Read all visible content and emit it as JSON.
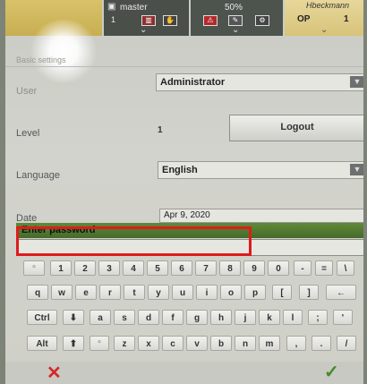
{
  "header": {
    "user_name": "master",
    "user_sub": "1",
    "zoom_percent": "50%",
    "op_label": "OP",
    "op_value": "1",
    "brand": "Hbeckmann"
  },
  "breadcrumb": "Basic settings",
  "form": {
    "user_label": "User",
    "user_value": "Administrator",
    "level_label": "Level",
    "level_value": "1",
    "logout_label": "Logout",
    "language_label": "Language",
    "language_value": "English",
    "date_label": "Date",
    "date_value": "Apr 9, 2020"
  },
  "password": {
    "prompt": "Enter password",
    "value": ""
  },
  "keyboard": {
    "row1": [
      "°",
      "1",
      "2",
      "3",
      "4",
      "5",
      "6",
      "7",
      "8",
      "9",
      "0",
      "-",
      "=",
      "\\"
    ],
    "row2": [
      "q",
      "w",
      "e",
      "r",
      "t",
      "y",
      "u",
      "i",
      "o",
      "p",
      "[",
      "]",
      "←"
    ],
    "row3": [
      "Ctrl",
      "⬇",
      "a",
      "s",
      "d",
      "f",
      "g",
      "h",
      "j",
      "k",
      "l",
      ";",
      "'"
    ],
    "row4": [
      "Alt",
      "⬆",
      "°",
      "z",
      "x",
      "c",
      "v",
      "b",
      "n",
      "m",
      ",",
      ".",
      "/"
    ]
  },
  "actions": {
    "cancel": "✕",
    "confirm": "✓"
  },
  "colors": {
    "prompt_bar": "#5f8a3a",
    "highlight_box": "#e01b1b",
    "cancel": "#d42a2a",
    "confirm": "#4a8a2a"
  }
}
